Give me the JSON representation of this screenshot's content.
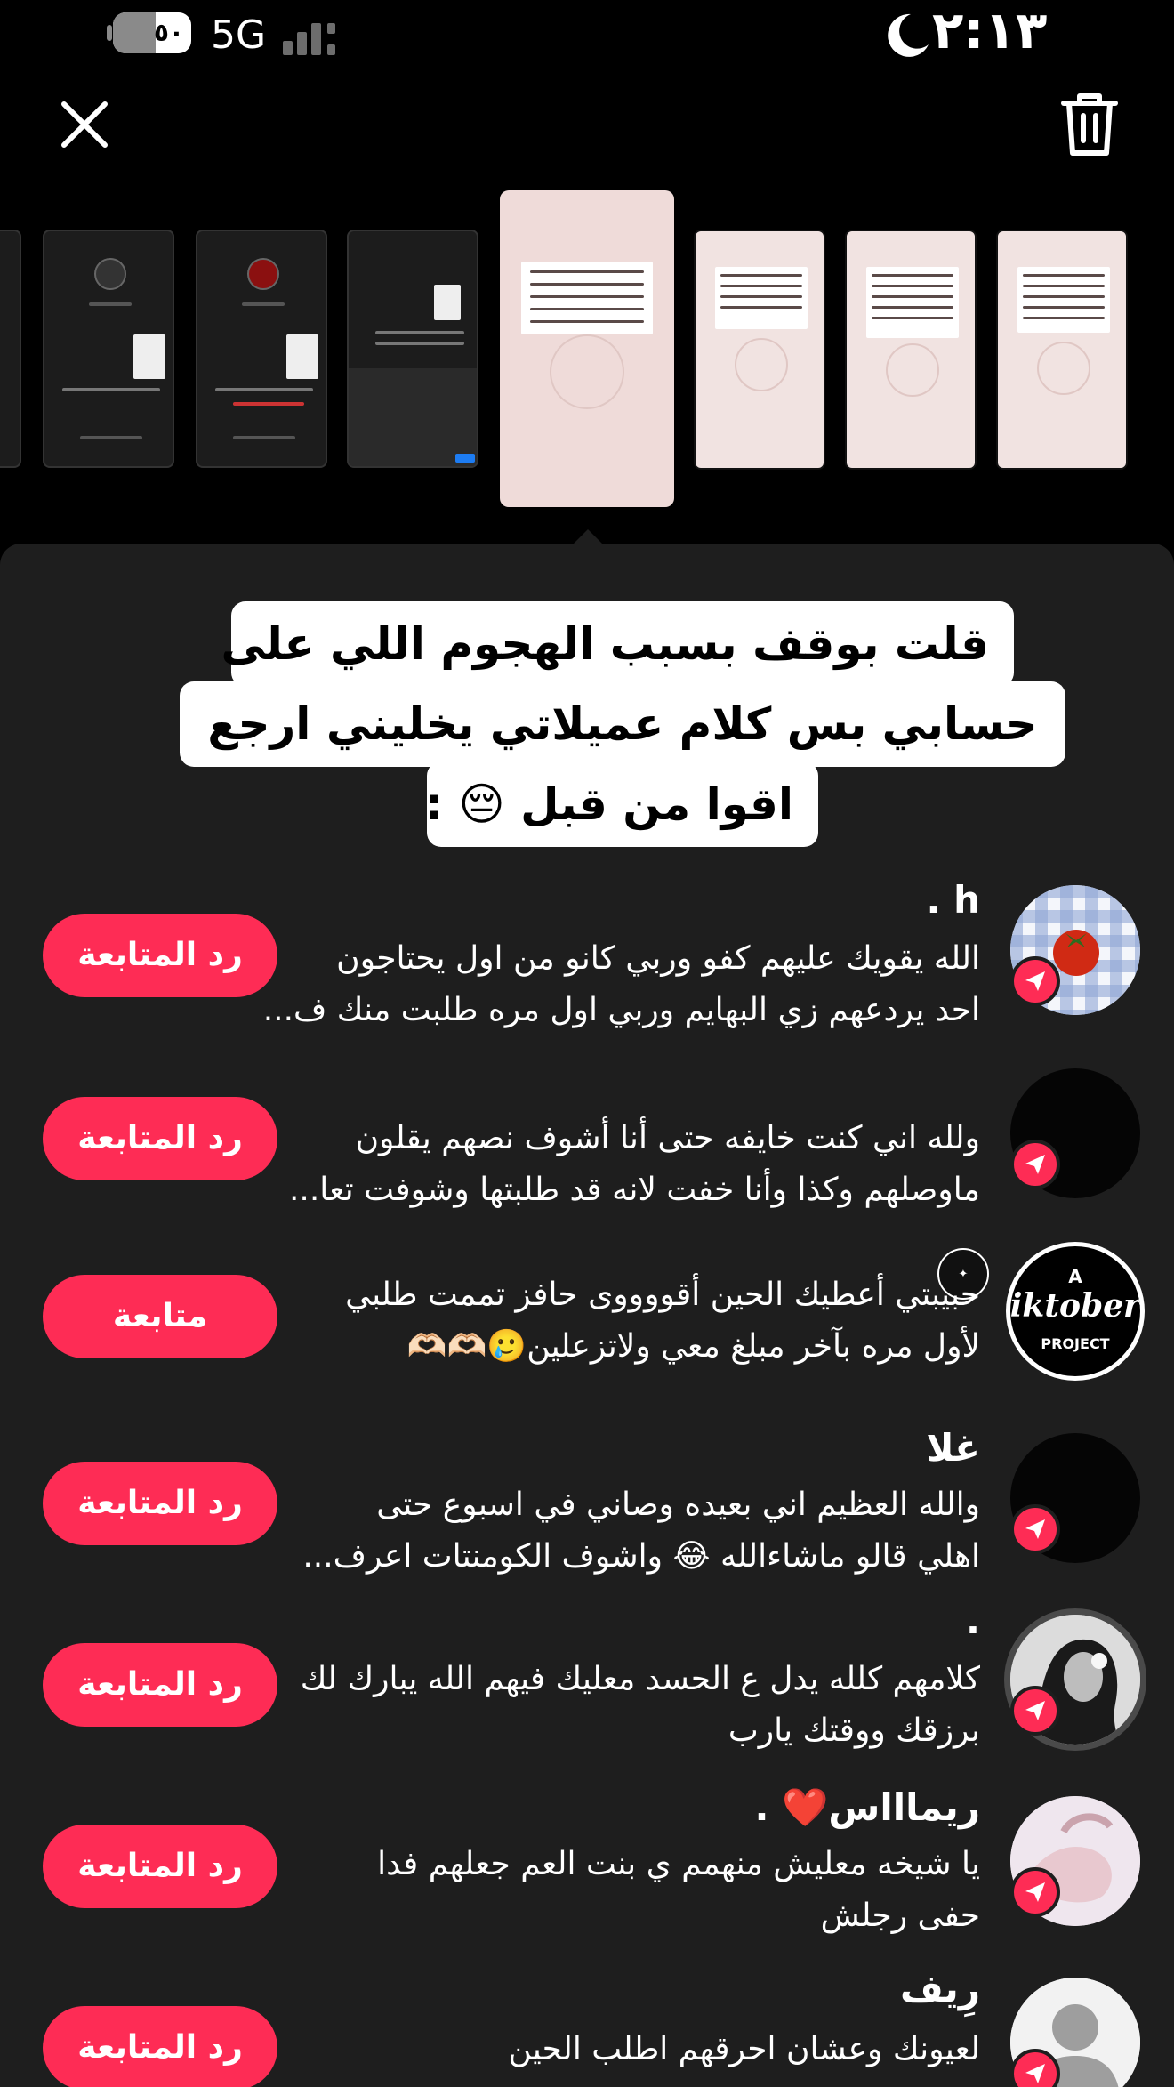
{
  "status_bar": {
    "battery_level": "٥٠",
    "network": "5G",
    "time": "٢:١٣"
  },
  "controls": {
    "close_icon": "close-icon",
    "trash_icon": "trash-icon"
  },
  "story_title": {
    "lines": [
      "قلت بوقف بسبب الهجوم اللي على",
      "حسابي بس كلام عميلاتي يخليني ارجع",
      "اقوا من قبل 😔 :"
    ]
  },
  "viewers": [
    {
      "name": "h .",
      "message_lines": [
        "الله يقويك عليهم كفو وربي كانو من اول يحتاجون",
        "احد يردعهم زي البهايم وربي اول مره طلبت منك ف..."
      ],
      "button_label": "رد المتابعة",
      "avatar": "tomato-photo"
    },
    {
      "name": "",
      "message_lines": [
        "ولله اني كنت خايفه حتى أنا أشوف نصهم يقلون",
        "ماوصلهم وكذا وأنا خفت لانه قد طلبتها وشوفت تعا..."
      ],
      "button_label": "رد المتابعة",
      "avatar": "black"
    },
    {
      "name": "",
      "message_lines": [
        "حبيبتي أعطيك الحين أقووووى حافز تممت طلبي",
        "لأول مره بآخر مبلغ معي ولاتزعلين🥲🫶🏻🫶🏻"
      ],
      "button_label": "متابعة",
      "avatar": "tiktober-logo",
      "avatar_text": [
        "A",
        "Tiktober",
        "PROJECT"
      ]
    },
    {
      "name": "غلا",
      "message_lines": [
        "والله العظيم اني بعيده وصاني في اسبوع حتى",
        "اهلي قالو ماشاءالله 😂 واشوف الكومنتات اعرف..."
      ],
      "button_label": "رد المتابعة",
      "avatar": "black"
    },
    {
      "name": ".",
      "message_lines": [
        "كلامهم كلله يدل ع الحسد معليك فيهم الله يبارك لك",
        "برزقك ووقتك يارب"
      ],
      "button_label": "رد المتابعة",
      "avatar": "woman-photo"
    },
    {
      "name": "ريماااس❤️ .",
      "message_lines": [
        "يا شيخه معليش منهمم ي بنت العم جعلهم فدا",
        "حفى رجلش"
      ],
      "button_label": "رد المتابعة",
      "avatar": "hand-photo"
    },
    {
      "name": "رِيف",
      "message_lines": [
        "لعيونك وعشان احرقهم اطلب الحين"
      ],
      "button_label": "رد المتابعة",
      "avatar": "default-user"
    }
  ],
  "colors": {
    "accent": "#fe2c55",
    "sheet_bg": "#1e1e1e",
    "story_bg": "#efdbd9"
  }
}
